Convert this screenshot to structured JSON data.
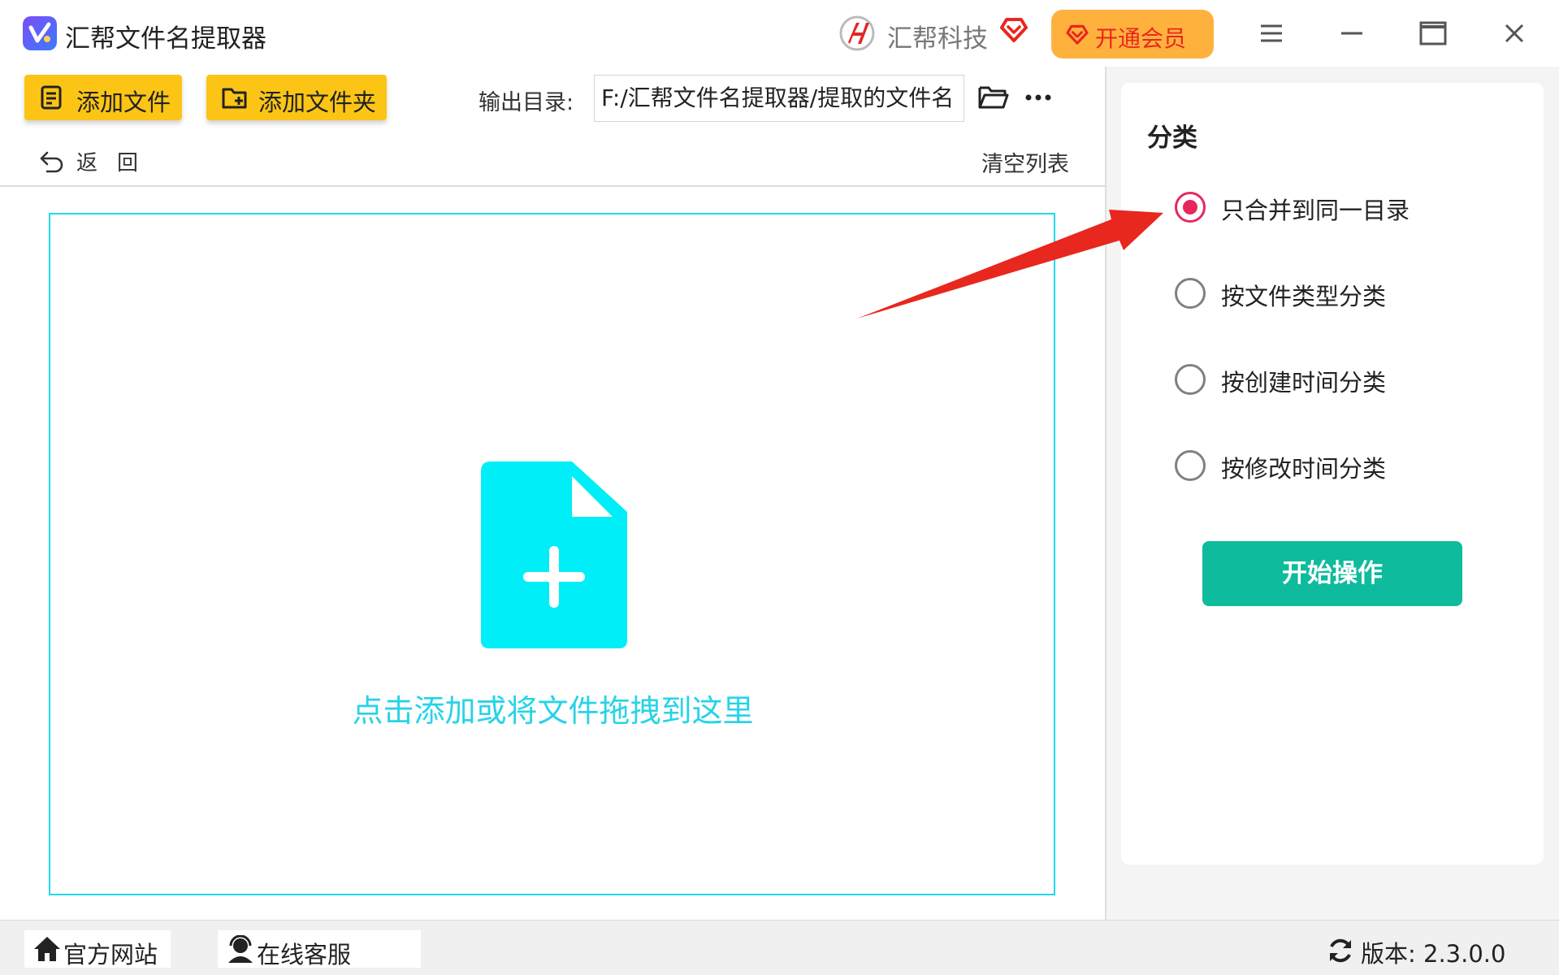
{
  "window": {
    "title": "汇帮文件名提取器",
    "brand_name": "汇帮科技",
    "vip_label": "开通会员"
  },
  "toolbar": {
    "add_file_label": "添加文件",
    "add_folder_label": "添加文件夹",
    "output_dir_label": "输出目录:",
    "output_dir_value": "F:/汇帮文件名提取器/提取的文件名",
    "back_label": "返回",
    "clear_list_label": "清空列表"
  },
  "dropzone": {
    "hint": "点击添加或将文件拖拽到这里"
  },
  "options": {
    "title": "分类",
    "radios": [
      {
        "label": "只合并到同一目录",
        "checked": true
      },
      {
        "label": "按文件类型分类",
        "checked": false
      },
      {
        "label": "按创建时间分类",
        "checked": false
      },
      {
        "label": "按修改时间分类",
        "checked": false
      }
    ],
    "start_label": "开始操作"
  },
  "statusbar": {
    "website_label": "官方网站",
    "support_label": "在线客服",
    "version_label": "版本: 2.3.0.0"
  },
  "colors": {
    "accent_yellow": "#fcc515",
    "drop_cyan": "#25d7ea",
    "start_green": "#0ebb9c",
    "radio_active": "#e8275d",
    "vip_orange": "#ffb13d",
    "annotation_red": "#e8271f"
  },
  "icons": {
    "app": "app-logo-icon",
    "brand": "brand-logo-icon",
    "vip": "diamond-heart-icon",
    "menu": "hamburger-menu-icon",
    "minimize": "minimize-icon",
    "maximize": "maximize-icon",
    "close": "close-icon",
    "add_file": "document-list-icon",
    "add_folder": "folder-plus-icon",
    "browse": "folder-open-icon",
    "more": "more-dots-icon",
    "back": "undo-arrow-icon",
    "drop": "file-plus-icon",
    "home": "home-icon",
    "support": "headset-user-icon",
    "refresh": "refresh-icon"
  }
}
